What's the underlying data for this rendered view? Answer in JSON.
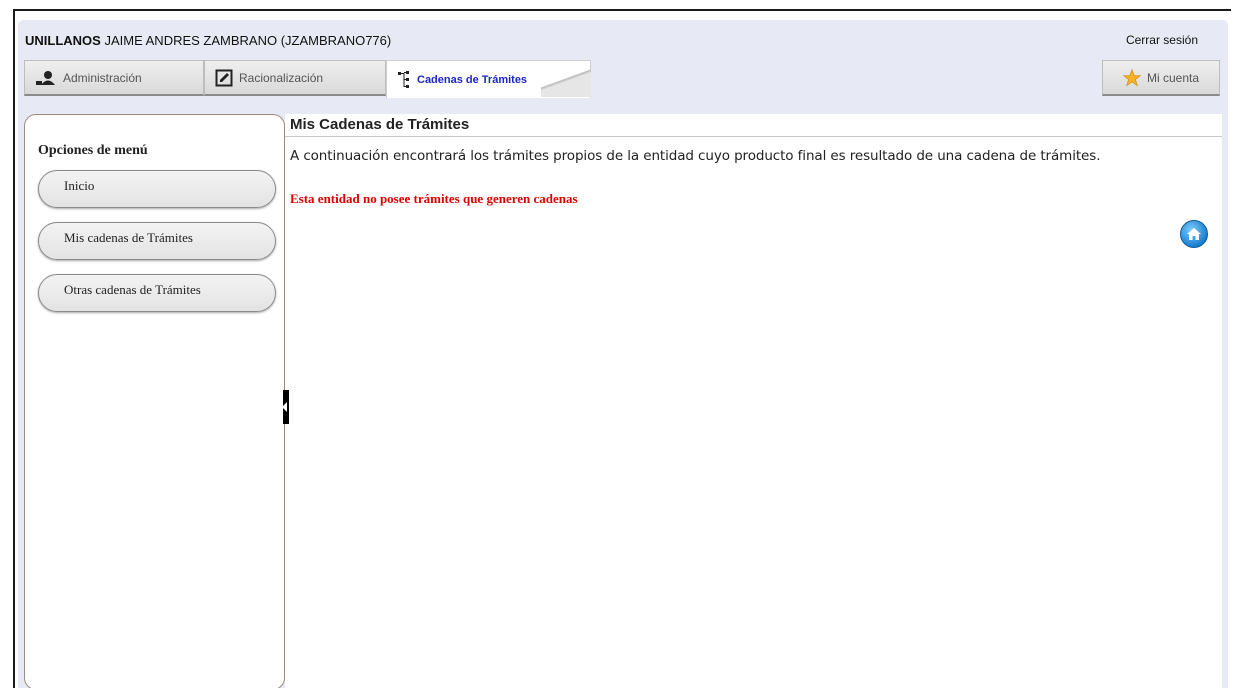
{
  "header": {
    "org": "UNILLANOS",
    "user": " JAIME ANDRES ZAMBRANO (JZAMBRANO776)",
    "logout_label": "Cerrar sesión"
  },
  "tabs": {
    "administracion": "Administración",
    "racionalizacion": "Racionalización",
    "cadenas": "Cadenas de Trámites",
    "mi_cuenta": "Mi cuenta"
  },
  "sidebar": {
    "title": "Opciones de menú",
    "items": [
      "Inicio",
      "Mis cadenas de Trámites",
      "Otras cadenas de Trámites"
    ]
  },
  "main": {
    "title": "Mis Cadenas de Trámites",
    "description": "A continuación encontrará los trámites propios de la entidad cuyo producto final es resultado de una cadena de trámites.",
    "warning": "Esta entidad no posee trámites que generen cadenas"
  },
  "colors": {
    "accent": "#1b27c6",
    "warning": "#e00000",
    "background": "#e7eaf4"
  },
  "icons": {
    "admin": "admin-user-icon",
    "racio": "edit-icon",
    "cadenas": "tree-icon",
    "cuenta": "star-icon",
    "home": "home-icon"
  }
}
